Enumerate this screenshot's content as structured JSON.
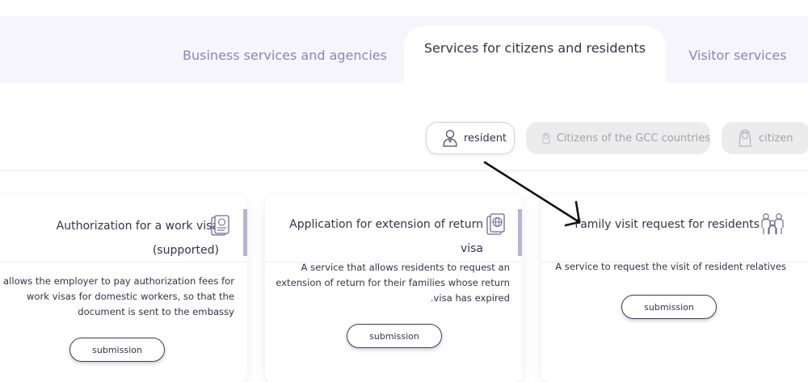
{
  "tabs": {
    "business": "Business services and agencies",
    "citizens": "Services for citizens and residents",
    "visitor": "Visitor services"
  },
  "categories": {
    "resident": "resident",
    "gcc": "Citizens of the GCC countries",
    "citizen": "citizen"
  },
  "cards": [
    {
      "title_line1": "Authorization for a work visa",
      "title_line2": "(supported)",
      "desc_line1": "It allows the employer to pay authorization fees for",
      "desc_line2": "work visas for domestic workers, so that the",
      "desc_line3": "document is sent to the embassy",
      "button": "submission",
      "icon": "passport-id-icon"
    },
    {
      "title_line1": "Application for extension of return visa",
      "desc_line1": "A service that allows residents to request an",
      "desc_line2": "extension of return for their families whose return",
      "desc_line3": ".visa has expired",
      "button": "submission",
      "icon": "passport-globe-icon"
    },
    {
      "title_line1": "Family visit request for residents",
      "desc_line1": "A service to request the visit of resident relatives",
      "button": "submission",
      "icon": "family-icon"
    }
  ],
  "colors": {
    "accent": "#8a86b8",
    "active_text": "#34344d",
    "tab_bg": "#f6f5fb",
    "chip_inactive_bg": "#ececec"
  }
}
